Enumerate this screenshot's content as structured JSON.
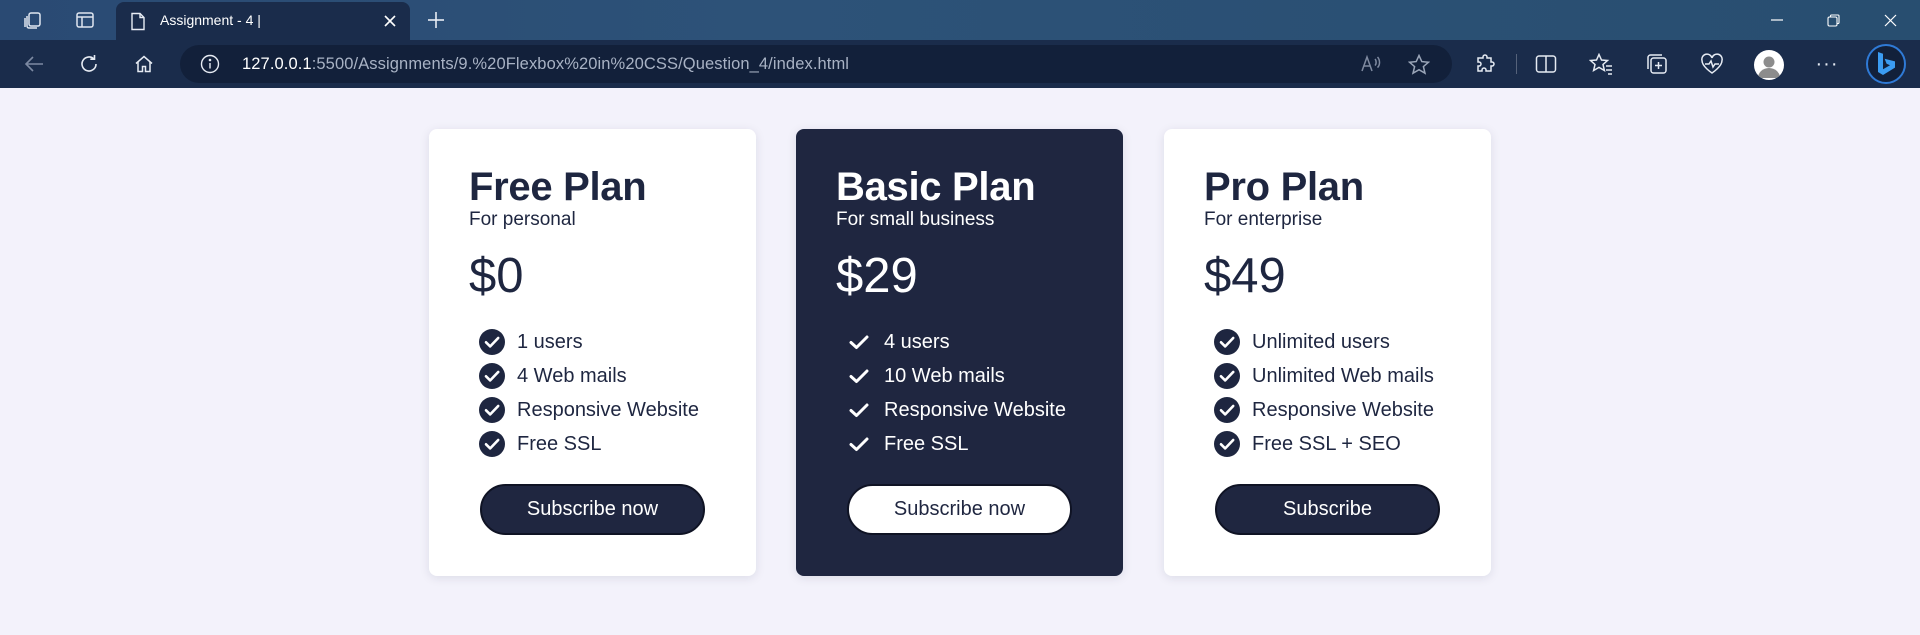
{
  "browser": {
    "tab_title": "Assignment - 4 |",
    "url_host": "127.0.0.1",
    "url_rest": ":5500/Assignments/9.%20Flexbox%20in%20CSS/Question_4/index.html",
    "read_aloud_icon_label": "Ă",
    "more_label": "···"
  },
  "plans": [
    {
      "name": "Free Plan",
      "subtitle": "For personal",
      "price": "$0",
      "features": [
        "1 users",
        "4 Web mails",
        "Responsive Website",
        "Free SSL"
      ],
      "button": "Subscribe now"
    },
    {
      "name": "Basic Plan",
      "subtitle": "For small business",
      "price": "$29",
      "features": [
        "4 users",
        "10 Web mails",
        "Responsive Website",
        "Free SSL"
      ],
      "button": "Subscribe now"
    },
    {
      "name": "Pro Plan",
      "subtitle": "For enterprise",
      "price": "$49",
      "features": [
        "Unlimited users",
        "Unlimited Web mails",
        "Responsive Website",
        "Free SSL + SEO"
      ],
      "button": "Subscribe"
    }
  ],
  "colors": {
    "page_background": "#f3f2fb",
    "card_background": "#ffffff",
    "dark_card_background": "#1f2640",
    "text_dark": "#1e2640",
    "browser_toolbar": "#1a2c4b"
  },
  "icons": {
    "feature_light": "check-circle-icon",
    "feature_dark": "check-icon"
  }
}
